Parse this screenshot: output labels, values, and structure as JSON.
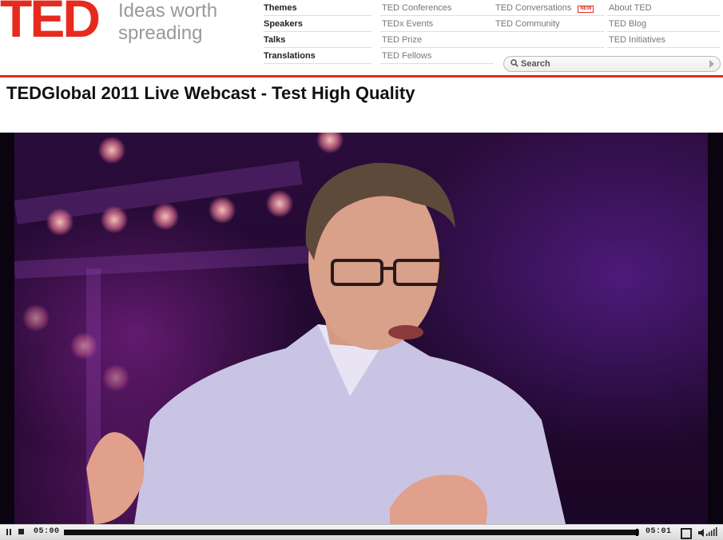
{
  "logo": {
    "mark": "TED",
    "tagline_line1": "Ideas worth",
    "tagline_line2": "spreading"
  },
  "nav": {
    "primary": [
      "Themes",
      "Speakers",
      "Talks",
      "Translations"
    ],
    "col2": [
      "TED Conferences",
      "TEDx Events",
      "TED Prize",
      "TED Fellows"
    ],
    "col3": [
      "TED Conversations",
      "TED Community"
    ],
    "col3_badge": "NEW",
    "col4": [
      "About TED",
      "TED Blog",
      "TED Initiatives"
    ]
  },
  "search": {
    "label": "Search",
    "icon": "magnifier-icon"
  },
  "page": {
    "title": "TEDGlobal 2011 Live Webcast - Test High Quality"
  },
  "player": {
    "current_time": "05:00",
    "total_time": "05:01",
    "progress": 0.997,
    "controls": [
      "pause-icon",
      "stop-icon",
      "fullscreen-icon",
      "volume-icon"
    ]
  },
  "colors": {
    "brand_red": "#e62b1e",
    "nav_gray": "#777777",
    "stage_purple": "#2a0c3a"
  }
}
